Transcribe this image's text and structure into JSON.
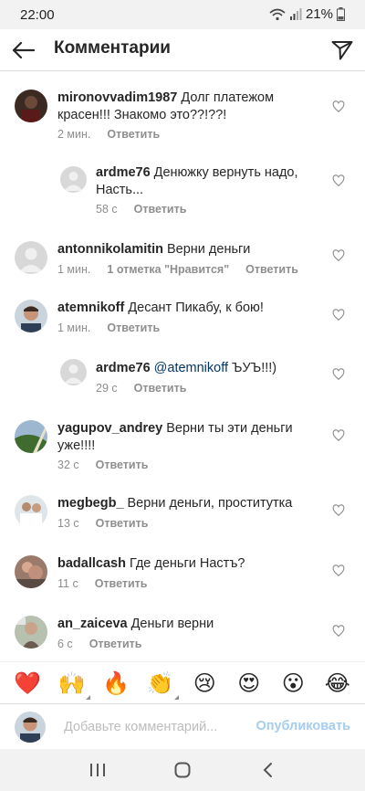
{
  "status": {
    "time": "22:00",
    "battery": "21%"
  },
  "header": {
    "title": "Комментарии"
  },
  "comments": [
    {
      "user": "mironovvadim1987",
      "text": "Долг платежом красен!!! Знакомо это??!??!",
      "time": "2 мин.",
      "reply": "Ответить"
    },
    {
      "user": "ardme76",
      "text": "Денюжку вернуть надо, Насть...",
      "time": "58 с",
      "reply": "Ответить"
    },
    {
      "user": "antonnikolamitin",
      "text": "Верни деньги",
      "time": "1 мин.",
      "likes": "1 отметка \"Нравится\"",
      "reply": "Ответить"
    },
    {
      "user": "atemnikoff",
      "text": "Десант Пикабу, к бою!",
      "time": "1 мин.",
      "reply": "Ответить"
    },
    {
      "user": "ardme76",
      "mention": "@atemnikoff",
      "text": "ЪУЪ!!!)",
      "time": "29 с",
      "reply": "Ответить"
    },
    {
      "user": "yagupov_andrey",
      "text": "Верни ты эти деньги уже!!!!",
      "time": "32 с",
      "reply": "Ответить"
    },
    {
      "user": "megbegb_",
      "text": "Верни деньги, проститутка",
      "time": "13 с",
      "reply": "Ответить"
    },
    {
      "user": "badallcash",
      "text": "Где деньги Настъ?",
      "time": "11 с",
      "reply": "Ответить"
    },
    {
      "user": "an_zaiceva",
      "text": "Деньги верни",
      "time": "6 с",
      "reply": "Ответить"
    }
  ],
  "emojis": [
    "❤️",
    "🙌",
    "🔥",
    "👏",
    "😢",
    "😍",
    "😮",
    "😂"
  ],
  "input": {
    "placeholder": "Добавьте комментарий...",
    "publish": "Опубликовать"
  },
  "colors": {
    "accent": "#0095f6",
    "publish_disabled": "#a5cdee",
    "muted": "#8e8e8e",
    "heart": "#ed2a2a"
  }
}
